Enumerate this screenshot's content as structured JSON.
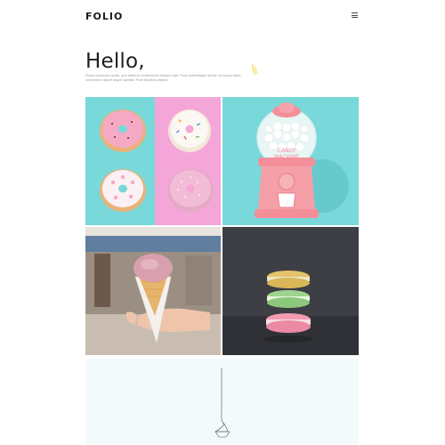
{
  "header": {
    "logo_text": "FOLIO",
    "menu_icon": "hamburger-icon"
  },
  "hero": {
    "title": "Hello,",
    "intro": "Donec commodo iaculis, quis eleifend condimentum tristique eget. Proin pellentesque lacinia. Ut cursus tellus, consectetur aliquet augue egestas. Proin faucibus dapibus.",
    "accent_icon": "lightning-bolt-icon"
  },
  "portfolio": {
    "tiles": [
      {
        "subject": "donuts"
      },
      {
        "subject": "candy-machine",
        "label_line1": "CANDY",
        "label_line2": "MACHINE"
      },
      {
        "subject": "ice-cream"
      },
      {
        "subject": "macarons"
      },
      {
        "subject": "hanging-lamp"
      }
    ]
  },
  "colors": {
    "teal": "#79d8d9",
    "pink": "#f5a6d9",
    "dark": "#3a3c42",
    "light": "#f2fafc",
    "accent_yellow": "#f3d21a"
  }
}
